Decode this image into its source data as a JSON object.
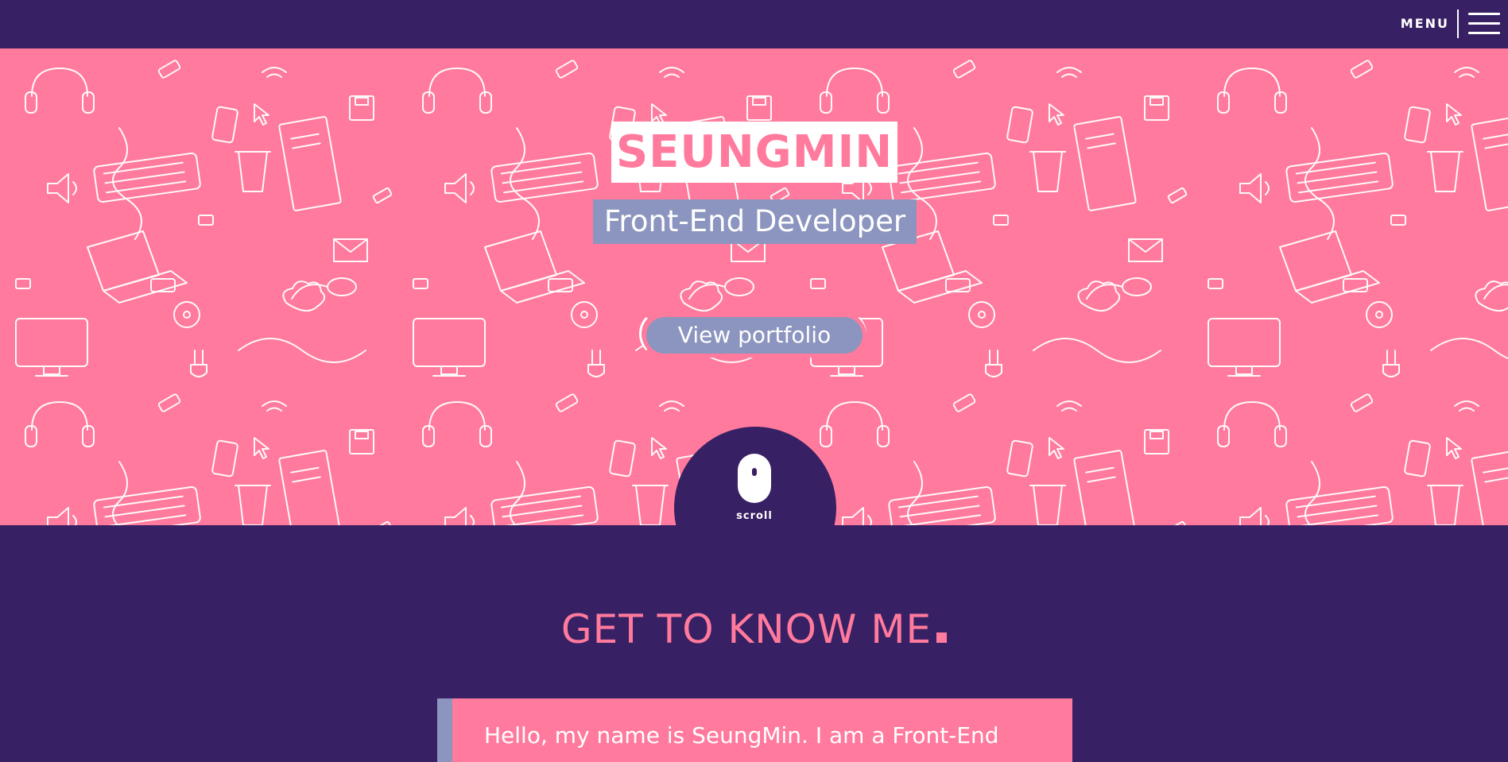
{
  "header": {
    "menu_label": "MENU",
    "menu_icon": "hamburger-icon"
  },
  "hero": {
    "name": "SEUNGMIN",
    "role": "Front-End Developer",
    "cta_label": "View portfolio",
    "scroll_label": "scroll",
    "scroll_icon": "mouse-icon",
    "background_pattern": "computer-doodle-pattern"
  },
  "about": {
    "title": "GET TO KNOW ME",
    "intro_text": "Hello, my name is SeungMin. I am a Front-End"
  },
  "colors": {
    "navy": "#382064",
    "pink": "#ff7a9c",
    "lavender": "#8c95bf",
    "white": "#ffffff"
  }
}
